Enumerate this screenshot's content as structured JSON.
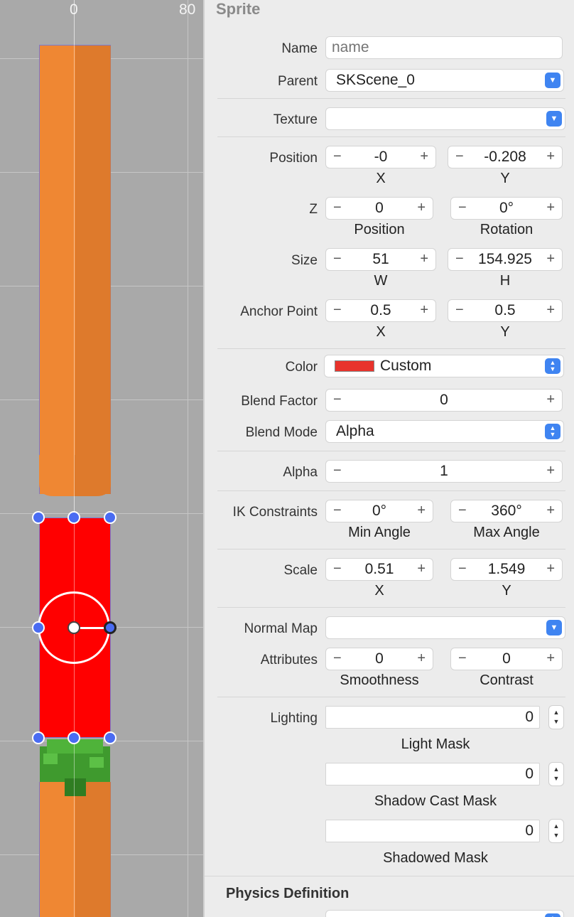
{
  "canvas": {
    "ruler": {
      "label_0": "0",
      "label_80": "80"
    }
  },
  "inspector": {
    "title": "Sprite",
    "name": {
      "label": "Name",
      "value": "",
      "placeholder": "name"
    },
    "parent": {
      "label": "Parent",
      "value": "SKScene_0"
    },
    "texture": {
      "label": "Texture",
      "value": ""
    },
    "position": {
      "label": "Position",
      "x": "-0",
      "y": "-0.208",
      "x_label": "X",
      "y_label": "Y"
    },
    "z": {
      "label": "Z",
      "position": "0",
      "rotation": "0°",
      "position_label": "Position",
      "rotation_label": "Rotation"
    },
    "size": {
      "label": "Size",
      "w": "51",
      "h": "154.925",
      "w_label": "W",
      "h_label": "H"
    },
    "anchor": {
      "label": "Anchor Point",
      "x": "0.5",
      "y": "0.5",
      "x_label": "X",
      "y_label": "Y"
    },
    "color": {
      "label": "Color",
      "value": "Custom",
      "swatch": "#e8332c"
    },
    "blend_factor": {
      "label": "Blend Factor",
      "value": "0"
    },
    "blend_mode": {
      "label": "Blend Mode",
      "value": "Alpha"
    },
    "alpha": {
      "label": "Alpha",
      "value": "1"
    },
    "ik": {
      "label": "IK Constraints",
      "min": "0°",
      "max": "360°",
      "min_label": "Min Angle",
      "max_label": "Max Angle"
    },
    "scale": {
      "label": "Scale",
      "x": "0.51",
      "y": "1.549",
      "x_label": "X",
      "y_label": "Y"
    },
    "normal_map": {
      "label": "Normal Map",
      "value": ""
    },
    "attributes": {
      "label": "Attributes",
      "smoothness": "0",
      "contrast": "0",
      "smoothness_label": "Smoothness",
      "contrast_label": "Contrast"
    },
    "lighting": {
      "label": "Lighting",
      "light_mask": "0",
      "light_mask_label": "Light Mask",
      "shadow_cast_mask": "0",
      "shadow_cast_mask_label": "Shadow Cast Mask",
      "shadowed_mask": "0",
      "shadowed_mask_label": "Shadowed Mask"
    },
    "physics_title": "Physics Definition"
  },
  "colors": {
    "accent": "#3f84f1",
    "sprite_red": "#ff0000",
    "carrot_orange": "#ef8733",
    "leaf_green": "#3f9a2e",
    "handle_blue": "#4a6cf2"
  }
}
